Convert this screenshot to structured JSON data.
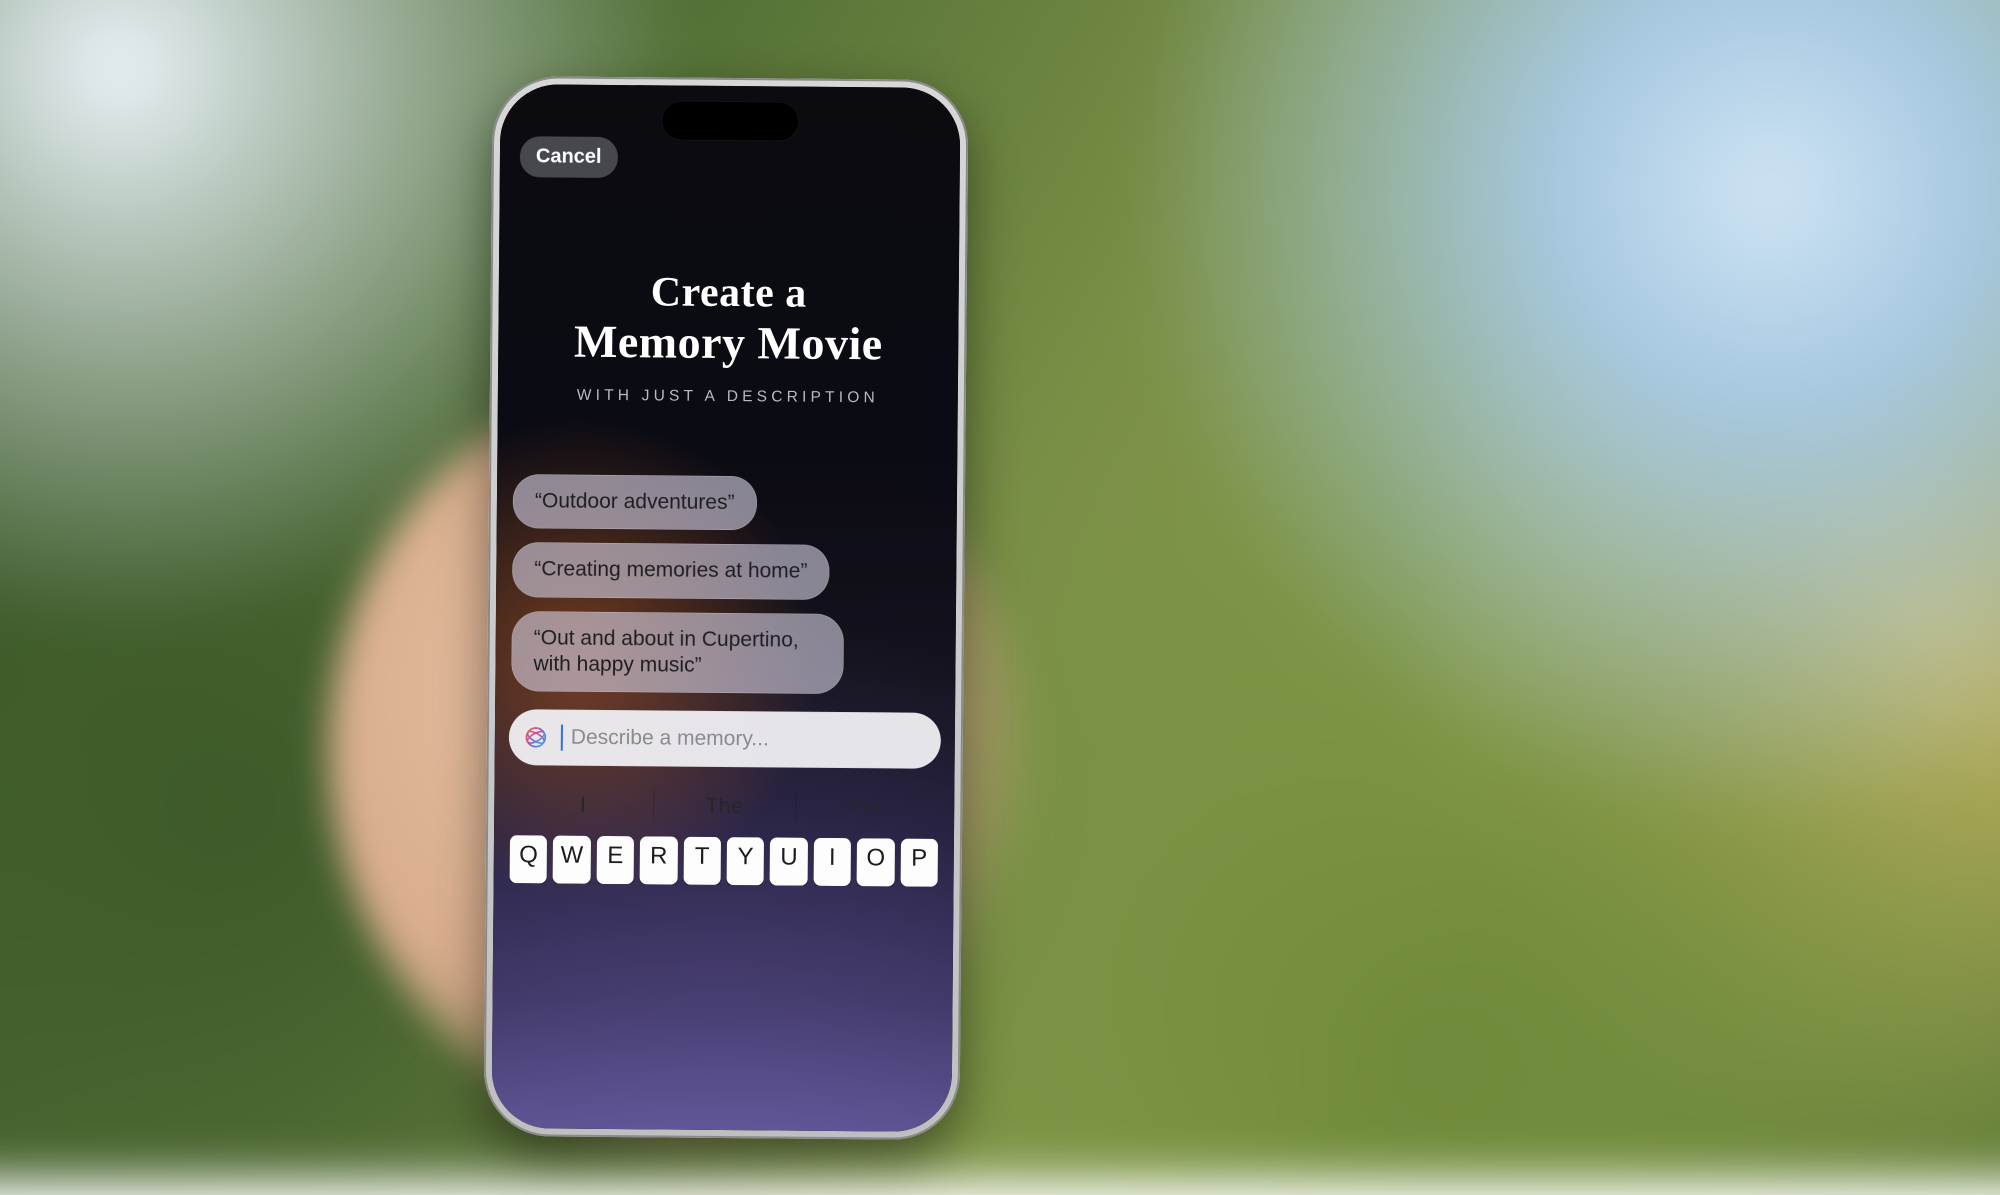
{
  "nav": {
    "cancel": "Cancel"
  },
  "heading": {
    "line1": "Create a",
    "line2": "Memory Movie"
  },
  "subheading": "WITH JUST A DESCRIPTION",
  "suggestions": [
    "“Outdoor adventures”",
    "“Creating memories at home”",
    "“Out and about in Cupertino, with happy music”"
  ],
  "input": {
    "placeholder": "Describe a memory...",
    "value": ""
  },
  "predictive": [
    "I",
    "The",
    "I’m"
  ],
  "keyboard_row1": [
    "Q",
    "W",
    "E",
    "R",
    "T",
    "Y",
    "U",
    "I",
    "O",
    "P"
  ]
}
